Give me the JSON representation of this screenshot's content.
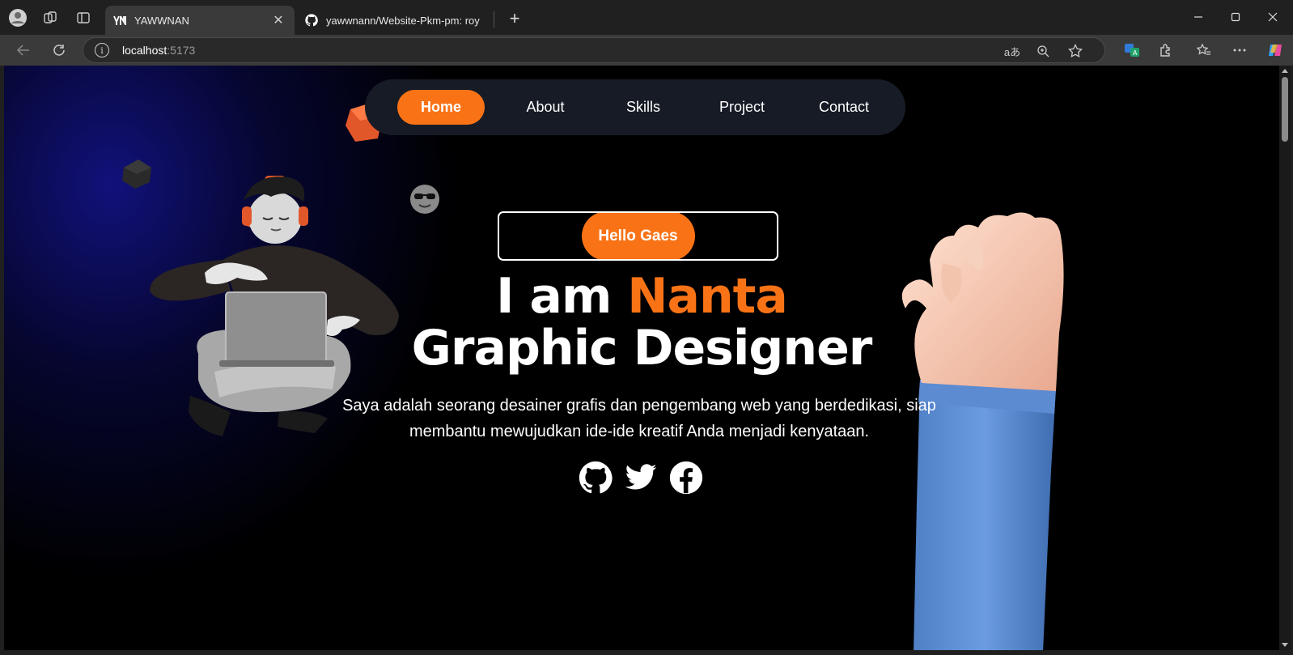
{
  "browser": {
    "tabs": [
      {
        "title": "YAWWNAN",
        "active": true
      },
      {
        "title": "yawwnann/Website-Pkm-pm: roy",
        "active": false
      }
    ],
    "address": {
      "host": "localhost",
      "port": ":5173"
    },
    "translate_label": "aあ"
  },
  "nav": {
    "items": [
      {
        "label": "Home",
        "active": true
      },
      {
        "label": "About",
        "active": false
      },
      {
        "label": "Skills",
        "active": false
      },
      {
        "label": "Project",
        "active": false
      },
      {
        "label": "Contact",
        "active": false
      }
    ]
  },
  "hero": {
    "badge": "Hello Gaes",
    "line1_prefix": "I am ",
    "line1_name": "Nanta",
    "line2": "Graphic Designer",
    "description": "Saya adalah seorang desainer grafis dan pengembang web yang berdedikasi, siap membantu mewujudkan ide-ide kreatif Anda menjadi kenyataan."
  },
  "socials": [
    {
      "icon": "github-icon"
    },
    {
      "icon": "twitter-icon"
    },
    {
      "icon": "facebook-icon"
    }
  ],
  "colors": {
    "accent": "#f97316",
    "nav_bg": "#161b25",
    "page_bg": "#000000"
  }
}
